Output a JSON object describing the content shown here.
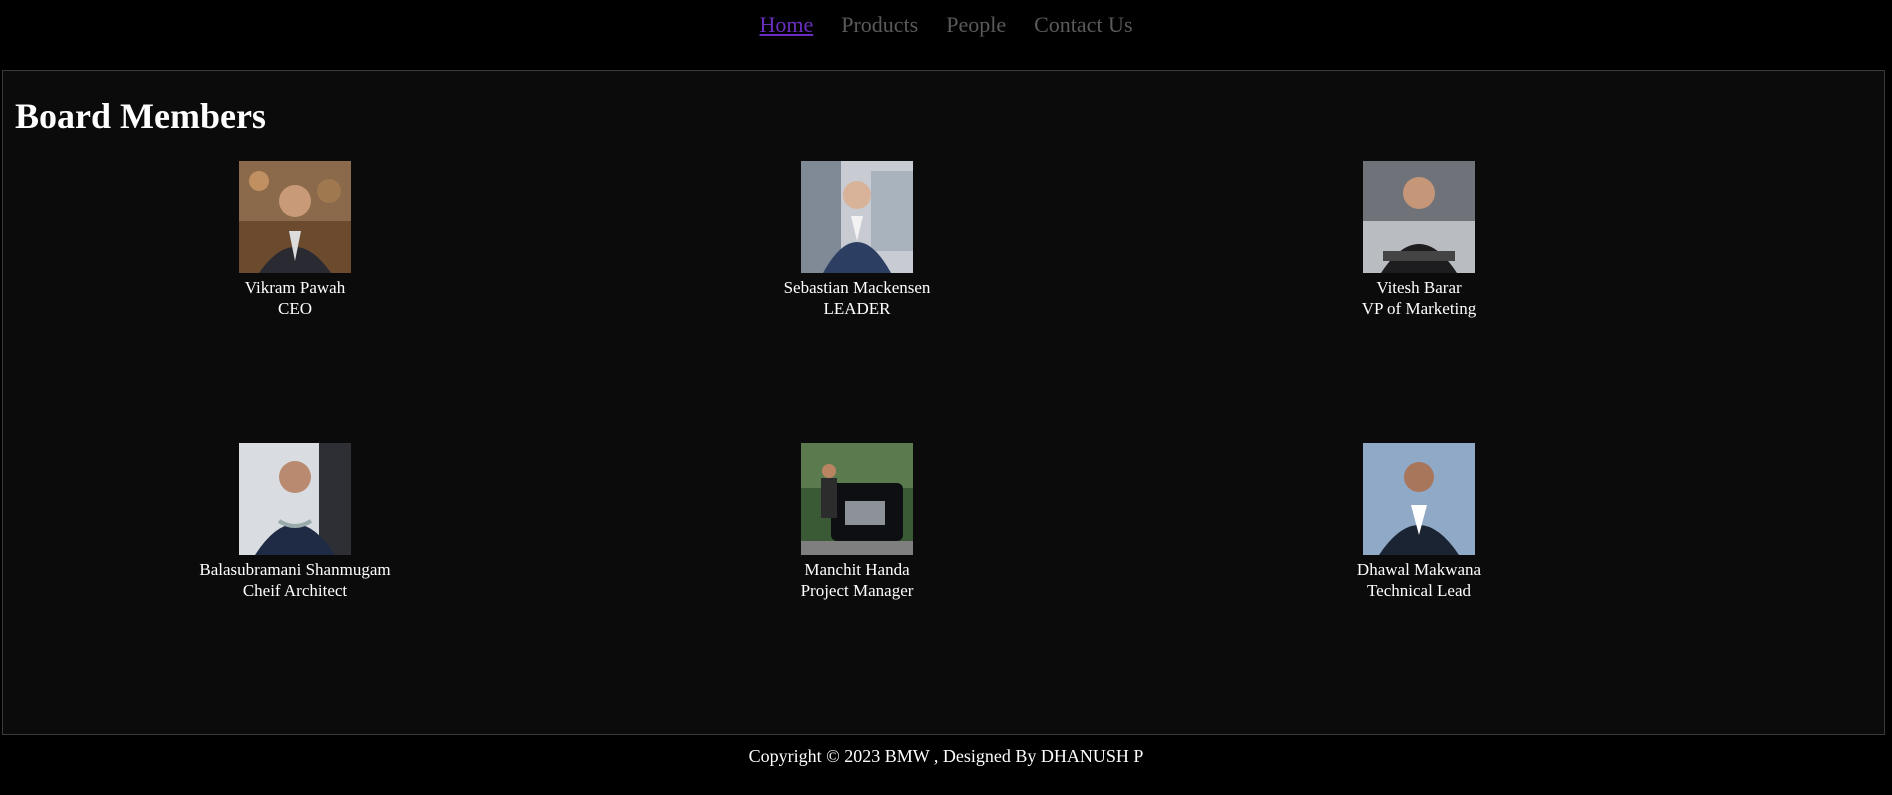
{
  "nav": {
    "items": [
      {
        "label": "Home",
        "active": true
      },
      {
        "label": "Products",
        "active": false
      },
      {
        "label": "People",
        "active": false
      },
      {
        "label": "Contact Us",
        "active": false
      }
    ]
  },
  "section": {
    "title": "Board Members"
  },
  "members": [
    {
      "name": "Vikram Pawah",
      "role": "CEO"
    },
    {
      "name": "Sebastian Mackensen",
      "role": "LEADER"
    },
    {
      "name": "Vitesh Barar",
      "role": "VP of Marketing"
    },
    {
      "name": "Balasubramani Shanmugam",
      "role": "Cheif Architect"
    },
    {
      "name": "Manchit Handa",
      "role": "Project Manager"
    },
    {
      "name": "Dhawal Makwana",
      "role": "Technical Lead"
    }
  ],
  "footer": {
    "text": "Copyright © 2023 BMW , Designed By DHANUSH P"
  },
  "colors": {
    "background": "#000000",
    "panel": "#0b0b0b",
    "nav_active": "#6a2ec0",
    "nav_inactive": "#5a5a5a",
    "text": "#ffffff"
  }
}
